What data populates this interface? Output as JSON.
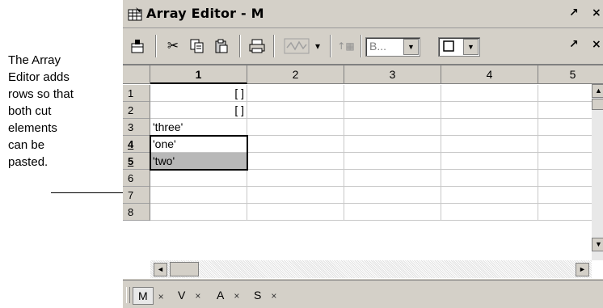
{
  "annotation": {
    "lines": [
      "The Array",
      "Editor adds",
      "rows so that",
      "both cut",
      "elements",
      "can be",
      "pasted."
    ]
  },
  "window": {
    "title": "Array Editor - M",
    "undock_glyph": "↗",
    "close_glyph": "×"
  },
  "toolbar": {
    "icons": [
      "import-data-icon",
      "cut-icon",
      "copy-icon",
      "paste-icon",
      "print-icon",
      "plot-icon",
      "dropdown-arrow-icon",
      "insert-icon"
    ],
    "base_select_value": "B...",
    "cut_glyph": "✂",
    "copy_glyph": "⎘",
    "paste_glyph": "📋",
    "print_glyph": "🖨",
    "insert_glyph": "↑▦",
    "dropdown_glyph": "▾",
    "combo_arrow_glyph": "▼"
  },
  "grid": {
    "columns": [
      "1",
      "2",
      "3",
      "4",
      "5"
    ],
    "selected_column": "1",
    "rows": [
      {
        "label": "1",
        "cells": [
          "[ ]",
          "",
          "",
          "",
          ""
        ]
      },
      {
        "label": "2",
        "cells": [
          "[ ]",
          "",
          "",
          "",
          ""
        ]
      },
      {
        "label": "3",
        "cells": [
          "'three'",
          "",
          "",
          "",
          ""
        ]
      },
      {
        "label": "4",
        "cells": [
          "'one'",
          "",
          "",
          "",
          ""
        ]
      },
      {
        "label": "5",
        "cells": [
          "'two'",
          "",
          "",
          "",
          ""
        ]
      },
      {
        "label": "6",
        "cells": [
          "",
          "",
          "",
          "",
          ""
        ]
      },
      {
        "label": "7",
        "cells": [
          "",
          "",
          "",
          "",
          ""
        ]
      },
      {
        "label": "8",
        "cells": [
          "",
          "",
          "",
          "",
          ""
        ]
      }
    ],
    "selected_rows": [
      "4",
      "5"
    ],
    "scroll_up_glyph": "▲",
    "scroll_down_glyph": "▼",
    "scroll_left_glyph": "◄",
    "scroll_right_glyph": "►"
  },
  "tabs": [
    {
      "label": "M",
      "close": "×",
      "active": true
    },
    {
      "label": "V",
      "close": "×",
      "active": false
    },
    {
      "label": "A",
      "close": "×",
      "active": false
    },
    {
      "label": "S",
      "close": "×",
      "active": false
    }
  ]
}
